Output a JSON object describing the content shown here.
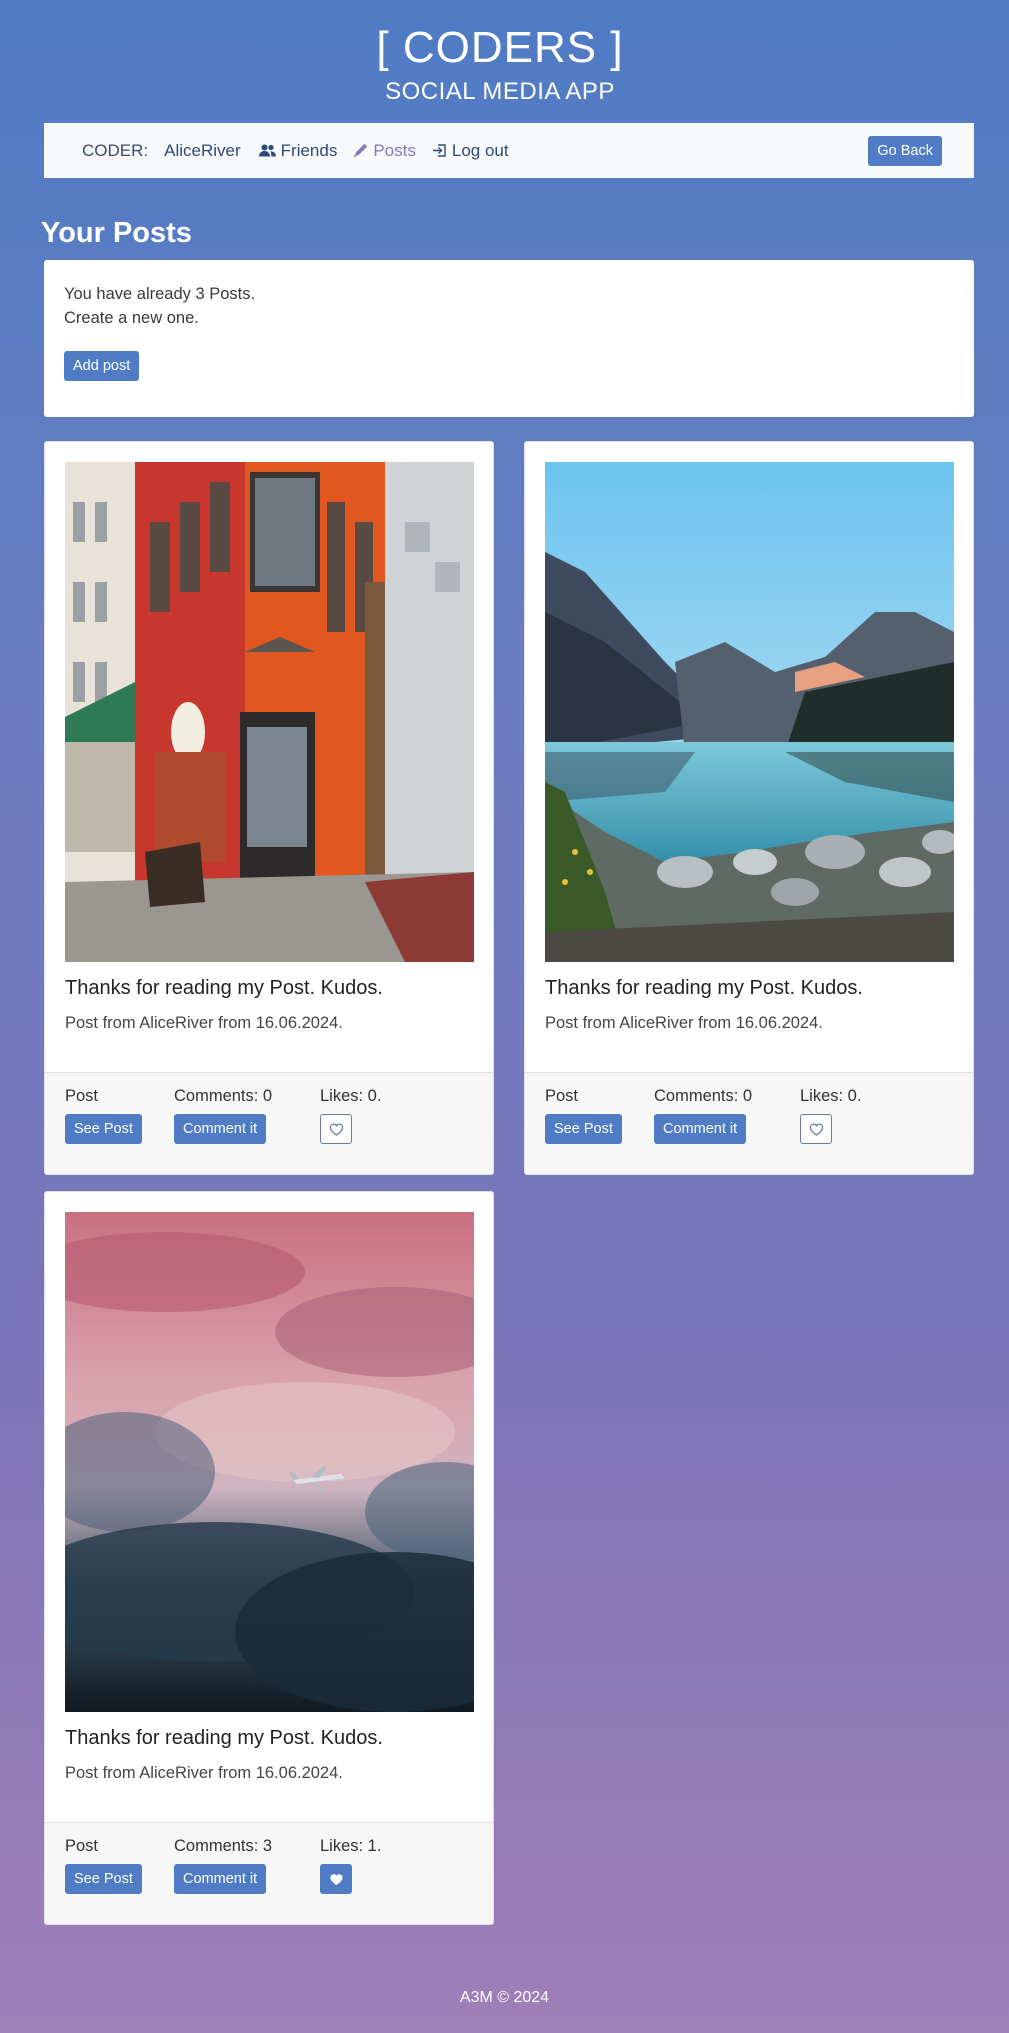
{
  "header": {
    "brand": "[ CODERS ]",
    "subtitle": "SOCIAL MEDIA APP"
  },
  "nav": {
    "coder_label": "CODER:",
    "username": "AliceRiver",
    "friends": "Friends",
    "posts": "Posts",
    "logout": "Log out",
    "go_back": "Go Back"
  },
  "section_title": "Your Posts",
  "info": {
    "line1": "You have already 3 Posts.",
    "line2": "Create a new one.",
    "add_post": "Add post"
  },
  "posts": [
    {
      "title": "Thanks for reading my Post. Kudos.",
      "meta": "Post from AliceRiver from 16.06.2024.",
      "post_label": "Post",
      "see_post": "See Post",
      "comments": "Comments: 0",
      "comment_it": "Comment it",
      "likes": "Likes: 0.",
      "liked": false,
      "image": "red-corner-shop-photo"
    },
    {
      "title": "Thanks for reading my Post. Kudos.",
      "meta": "Post from AliceRiver from 16.06.2024.",
      "post_label": "Post",
      "see_post": "See Post",
      "comments": "Comments: 0",
      "comment_it": "Comment it",
      "likes": "Likes: 0.",
      "liked": false,
      "image": "mountain-lake-photo"
    },
    {
      "title": "Thanks for reading my Post. Kudos.",
      "meta": "Post from AliceRiver from 16.06.2024.",
      "post_label": "Post",
      "see_post": "See Post",
      "comments": "Comments: 3",
      "comment_it": "Comment it",
      "likes": "Likes: 1.",
      "liked": true,
      "image": "airplane-sky-photo"
    }
  ],
  "footer": "A3M © 2024",
  "colors": {
    "primary": "#4f7cc5",
    "active_nav": "#8a78c0",
    "navbar_bg": "#f8f9fa"
  }
}
